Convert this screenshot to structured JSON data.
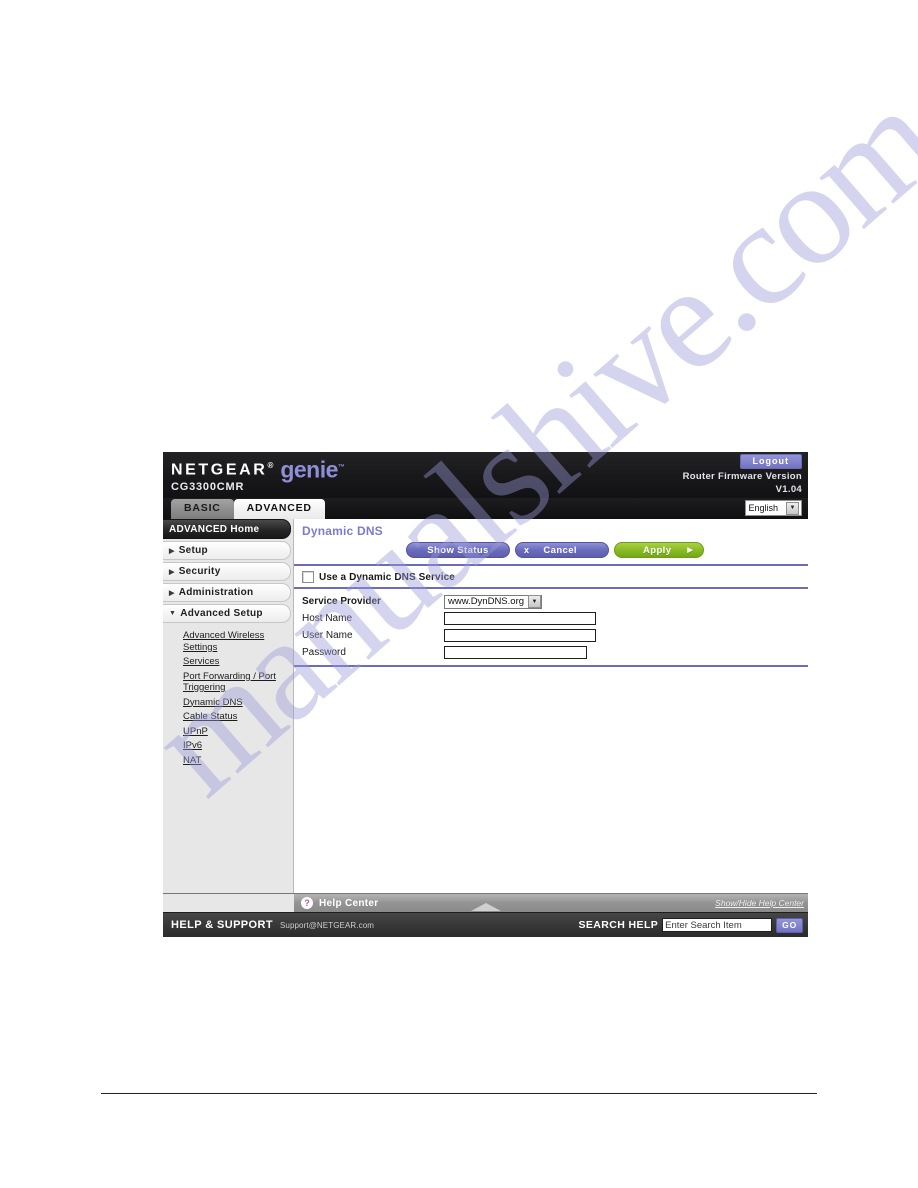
{
  "watermark": {
    "text": "manualshive.com"
  },
  "header": {
    "brand_netgear": "NETGEAR",
    "brand_reg": "®",
    "brand_genie": "genie",
    "brand_tm": "™",
    "model": "CG3300CMR",
    "logout_label": "Logout",
    "firmware_label": "Router Firmware Version",
    "firmware_version": "V1.04"
  },
  "tabs": [
    {
      "label": "BASIC",
      "state": "inactive"
    },
    {
      "label": "ADVANCED",
      "state": "active"
    }
  ],
  "language": {
    "selected": "English",
    "caret_icon": "chevron-down-icon"
  },
  "sidebar": {
    "home_label": "ADVANCED Home",
    "groups": [
      {
        "label": "Setup",
        "expanded": false,
        "arrow_icon": "chevron-right-icon"
      },
      {
        "label": "Security",
        "expanded": false,
        "arrow_icon": "chevron-right-icon"
      },
      {
        "label": "Administration",
        "expanded": false,
        "arrow_icon": "chevron-right-icon"
      },
      {
        "label": "Advanced Setup",
        "expanded": true,
        "arrow_icon": "chevron-down-icon"
      }
    ],
    "sublinks": [
      "Advanced Wireless Settings",
      "Services",
      "Port Forwarding / Port Triggering",
      "Dynamic DNS",
      "Cable Status",
      "UPnP",
      "IPv6",
      "NAT"
    ]
  },
  "main": {
    "page_title": "Dynamic DNS",
    "buttons": {
      "show_status": "Show Status",
      "cancel": "Cancel",
      "cancel_icon": "x-icon",
      "apply": "Apply",
      "apply_icon": "chevron-right-icon"
    },
    "checkbox": {
      "label": "Use a Dynamic DNS Service",
      "checked": false
    },
    "fields": [
      {
        "label": "Service Provider",
        "type": "select",
        "value": "www.DynDNS.org"
      },
      {
        "label": "Host Name",
        "type": "text",
        "value": ""
      },
      {
        "label": "User Name",
        "type": "text",
        "value": ""
      },
      {
        "label": "Password",
        "type": "password",
        "value": ""
      }
    ]
  },
  "help_bar": {
    "icon": "question-mark-icon",
    "label": "Help Center",
    "collapse_icon": "chevron-up-icon",
    "toggle_link": "Show/Hide Help Center"
  },
  "footer": {
    "help_support": "HELP & SUPPORT",
    "email": "Support@NETGEAR.com",
    "search_label": "SEARCH HELP",
    "search_placeholder": "Enter Search Item",
    "go_label": "GO"
  },
  "colors": {
    "accent_purple": "#7273c4",
    "accent_green": "#8fbf2a",
    "header_black": "#19191b",
    "sidebar_gray": "#e7e7e7",
    "title_purple": "#7b7cc9",
    "rule_navy": "#1b1b7a"
  }
}
